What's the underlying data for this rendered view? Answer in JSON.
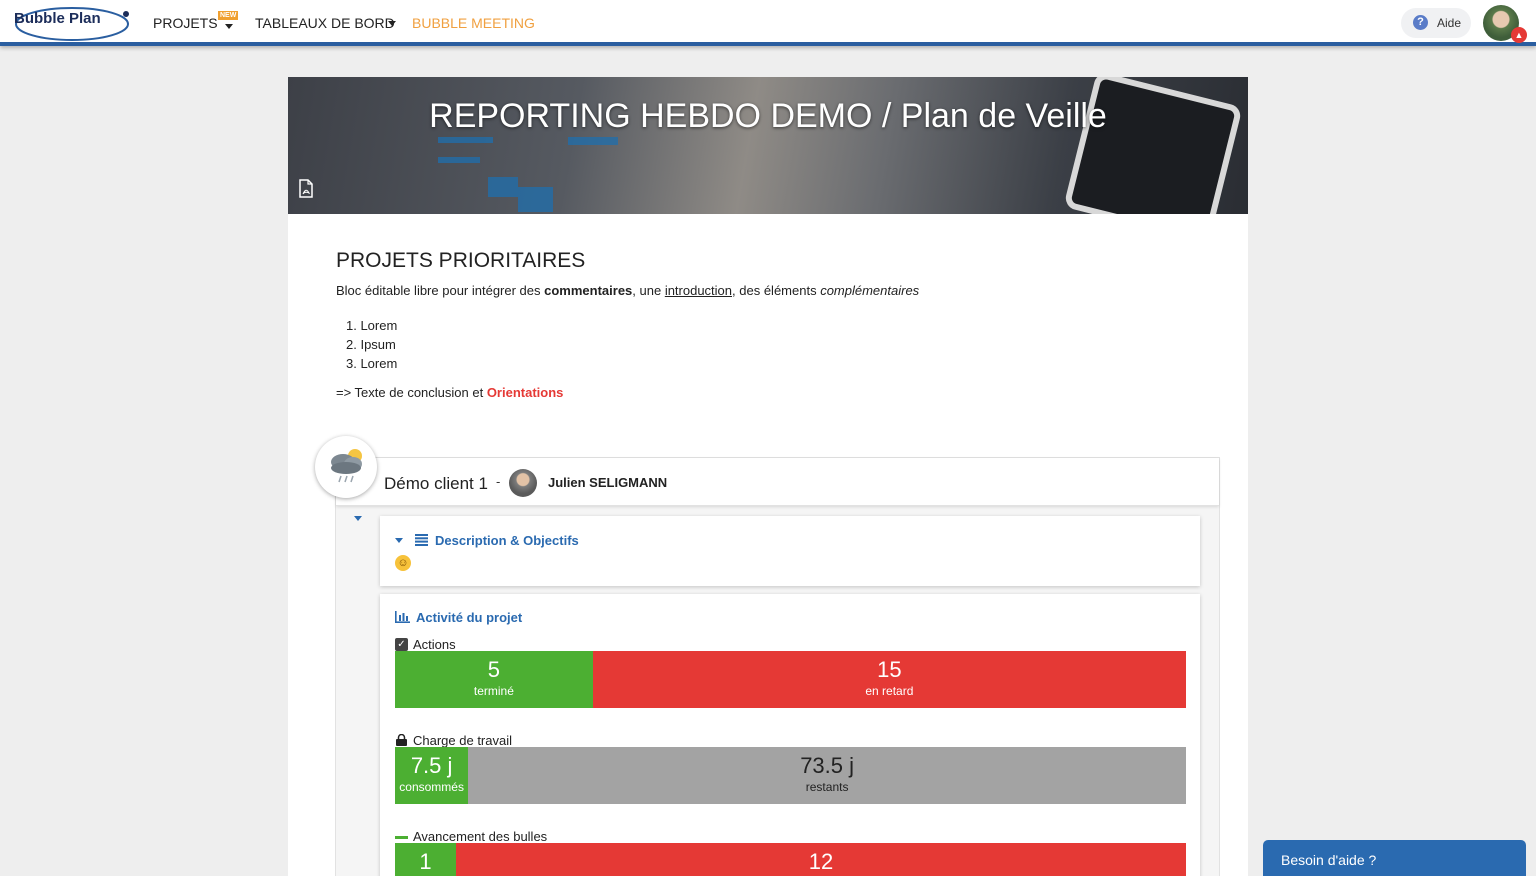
{
  "nav": {
    "logo": "Bubble Plan",
    "projets": "PROJETS",
    "new_badge": "NEW",
    "tableaux": "TABLEAUX DE BORD",
    "meeting": "BUBBLE MEETING",
    "help": "Aide",
    "help_icon": "?"
  },
  "banner": {
    "title": "REPORTING HEBDO DEMO / Plan de Veille",
    "pdf_icon": "pdf-icon"
  },
  "content": {
    "section_title": "PROJETS PRIORITAIRES",
    "intro_part1": "Bloc éditable libre pour intégrer des ",
    "intro_bold": "commentaires",
    "intro_part2": ", une ",
    "intro_underline": "introduction",
    "intro_part3": ", des éléments ",
    "intro_italic": "complémentaires",
    "list": [
      "1. Lorem",
      "2. Ipsum",
      "3. Lorem"
    ],
    "conclusion_prefix": "=> Texte de conclusion et ",
    "conclusion_highlight": "Orientations"
  },
  "project": {
    "client": "Démo client 1",
    "separator": "-",
    "owner": "Julien SELIGMANN",
    "description_heading": "Description & Objectifs",
    "description_emoji": "☺",
    "activity_heading": "Activité du projet",
    "actions_label": "Actions",
    "actions": [
      {
        "value": "5",
        "label": "terminé",
        "status": "done",
        "fraction": 0.25
      },
      {
        "value": "15",
        "label": "en retard",
        "status": "late",
        "fraction": 0.75
      }
    ],
    "workload_label": "Charge de travail",
    "workload": [
      {
        "value": "7.5 j",
        "label": "consommés",
        "fraction": 0.0926
      },
      {
        "value": "73.5 j",
        "label": "restants",
        "fraction": 0.9074
      }
    ],
    "bubbles_label": "Avancement des bulles",
    "bubbles": [
      {
        "value": "1",
        "fraction": 0.077
      },
      {
        "value": "12",
        "fraction": 0.923
      }
    ]
  },
  "chat": {
    "label": "Besoin d'aide ?"
  },
  "colors": {
    "accent": "#2a6ab0",
    "green": "#4caf32",
    "red": "#e53935",
    "grey": "#a3a3a3",
    "meeting": "#f0a040"
  }
}
